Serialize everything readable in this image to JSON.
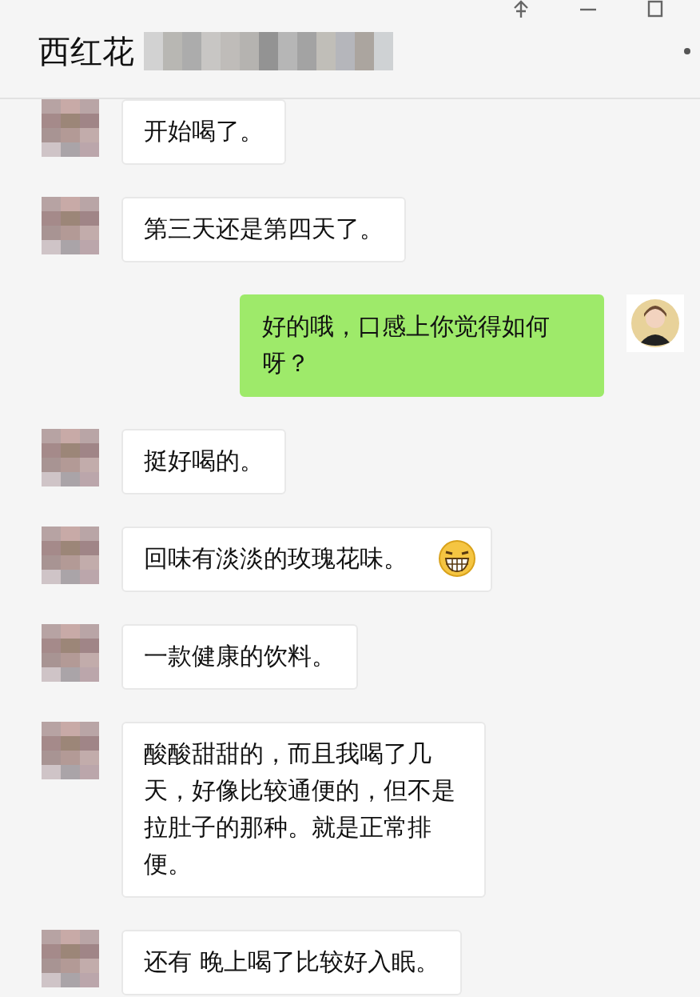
{
  "window": {
    "title": "西红花"
  },
  "messages": [
    {
      "kind": "incoming",
      "text": "开始喝了。"
    },
    {
      "kind": "incoming",
      "text": "第三天还是第四天了。"
    },
    {
      "kind": "outgoing",
      "text": "好的哦，口感上你觉得如何呀？"
    },
    {
      "kind": "incoming",
      "text": "挺好喝的。"
    },
    {
      "kind": "incoming",
      "text": "回味有淡淡的玫瑰花味。",
      "emoji": true
    },
    {
      "kind": "incoming",
      "text": "一款健康的饮料。"
    },
    {
      "kind": "incoming",
      "text": "酸酸甜甜的，而且我喝了几天，好像比较通便的，但不是拉肚子的那种。就是正常排便。"
    },
    {
      "kind": "incoming",
      "text": "还有 晚上喝了比较好入眠。"
    }
  ]
}
